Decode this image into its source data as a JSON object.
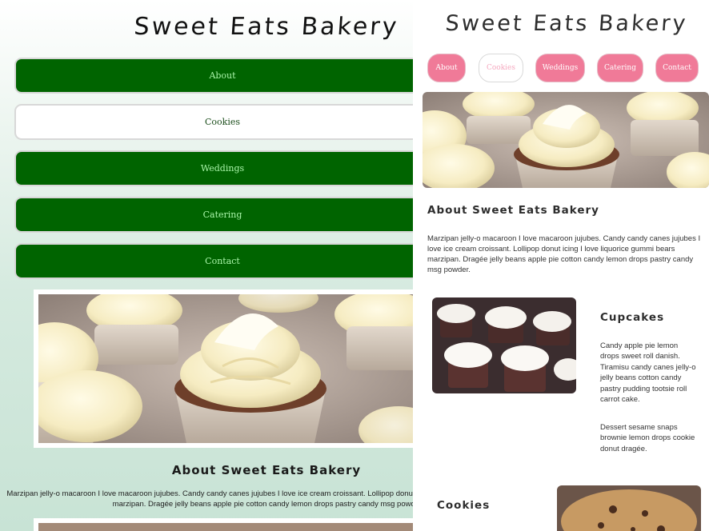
{
  "site_title": "Sweet Eats Bakery",
  "nav": [
    {
      "label": "About",
      "active": false
    },
    {
      "label": "Cookies",
      "active": true
    },
    {
      "label": "Weddings",
      "active": false
    },
    {
      "label": "Catering",
      "active": false
    },
    {
      "label": "Contact",
      "active": false
    }
  ],
  "about": {
    "title": "About Sweet Eats Bakery",
    "text_mobile": "Marzipan jelly-o macaroon I love macaroon jujubes. Candy candy canes jujubes I love ice cream croissant. Lollipop donut icing I love liquorice gummi bears marzipan. Dragée jelly beans apple pie cotton candy lemon drops pastry candy msg powder.",
    "text": "Marzipan jelly-o macaroon I love macaroon jujubes. Candy candy canes jujubes I love ice cream croissant. Lollipop donut icing I love liquorice gummi bears marzipan. Dragée jelly beans apple pie cotton candy lemon drops pastry candy msg powder."
  },
  "cupcakes": {
    "title": "Cupcakes",
    "text1": "Candy apple pie lemon drops sweet roll danish. Tiramisu candy canes jelly-o jelly beans cotton candy pastry pudding tootsie roll carrot cake.",
    "text2": "Dessert sesame snaps brownie lemon drops cookie donut dragée."
  },
  "cookies": {
    "title": "Cookies"
  },
  "colors": {
    "mobile_nav_green": "#006400",
    "mobile_nav_text": "#a9f5a9",
    "desktop_nav_pink": "#f07a98",
    "active_text_pink": "#f5a9bf"
  },
  "images": {
    "hero": "cupcakes-frosting-photo",
    "cupcakes": "chocolate-cupcakes-photo",
    "cookies": "cookies-photo"
  }
}
